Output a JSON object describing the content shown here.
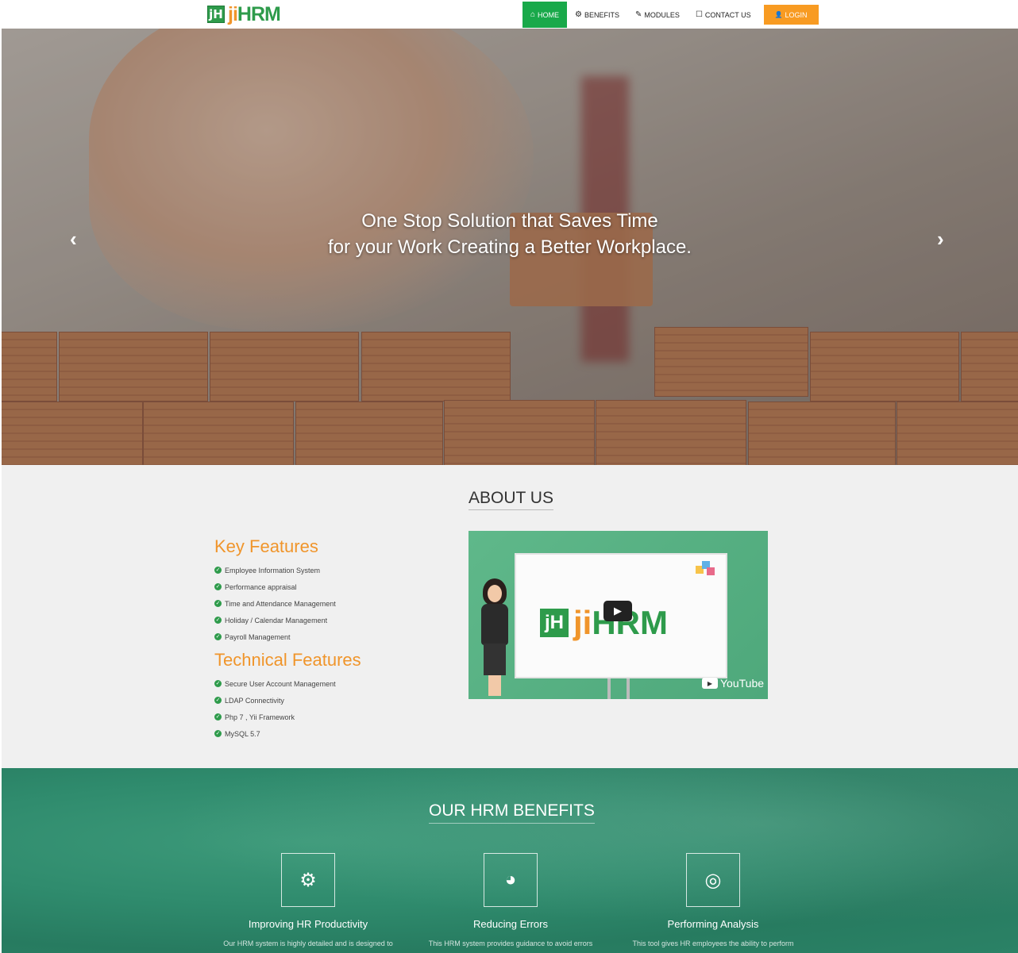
{
  "brand": {
    "logo_mark": "jH",
    "name_ji": "ji",
    "name_hrm": "HRM"
  },
  "nav": {
    "items": [
      {
        "label": "HOME",
        "icon": "home-icon",
        "glyph": "⌂"
      },
      {
        "label": "BENEFITS",
        "icon": "gear-circle-icon",
        "glyph": "⚙"
      },
      {
        "label": "MODULES",
        "icon": "pencil-icon",
        "glyph": "✎"
      },
      {
        "label": "CONTACT US",
        "icon": "phone-icon",
        "glyph": "☐"
      }
    ],
    "login": {
      "label": "LOGIN",
      "icon": "user-icon",
      "glyph": "👤"
    }
  },
  "hero": {
    "line1": "One Stop Solution that Saves Time",
    "line2": "for your Work Creating a Better Workplace.",
    "prev_glyph": "‹",
    "next_glyph": "›"
  },
  "about": {
    "title": "ABOUT US",
    "key_features": {
      "heading": "Key Features",
      "items": [
        "Employee Information System",
        "Performance appraisal",
        "Time and Attendance Management",
        "Holiday / Calendar Management",
        "Payroll Management"
      ]
    },
    "technical_features": {
      "heading": "Technical Features",
      "items": [
        "Secure User Account Management",
        "LDAP Connectivity",
        "Php 7 , Yii Framework",
        "MySQL 5.7"
      ]
    },
    "video": {
      "logo_mark": "jH",
      "logo_ji": "ji",
      "logo_hrm": "HRM",
      "play_glyph": "▶",
      "youtube_label": "YouTube"
    }
  },
  "benefits": {
    "title": "OUR HRM BENEFITS",
    "cards": [
      {
        "icon": "gears-icon",
        "glyph": "⚙",
        "title": "Improving HR Productivity",
        "desc": "Our HRM system is highly detailed and is designed to"
      },
      {
        "icon": "pie-chart-icon",
        "glyph": "◕",
        "title": "Reducing Errors",
        "desc": "This HRM system provides guidance to avoid errors"
      },
      {
        "icon": "target-icon",
        "glyph": "◎",
        "title": "Performing Analysis",
        "desc": "This tool gives HR employees the ability to perform"
      }
    ]
  },
  "colors": {
    "green": "#19a94a",
    "orange": "#f89b22",
    "teal": "#2f8b6d"
  }
}
